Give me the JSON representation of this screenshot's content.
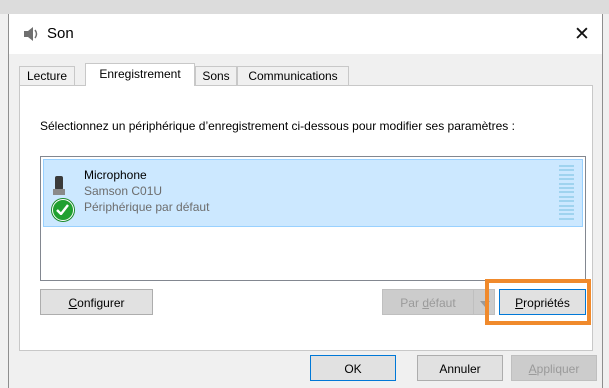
{
  "window": {
    "title": "Son",
    "title_icon": "speaker-icon",
    "close_label": "✕"
  },
  "tabs": [
    {
      "label": "Lecture",
      "active": false
    },
    {
      "label": "Enregistrement",
      "active": true
    },
    {
      "label": "Sons",
      "active": false
    },
    {
      "label": "Communications",
      "active": false
    }
  ],
  "instruction": "Sélectionnez un périphérique d’enregistrement ci-dessous pour modifier ses paramètres :",
  "device": {
    "name": "Microphone",
    "model": "Samson C01U",
    "status": "Périphérique par défaut",
    "icon": "microphone-icon",
    "status_icon": "checkmark-icon",
    "level_segments": 13
  },
  "buttons": {
    "configure": {
      "mnemonic": "C",
      "rest": "onfigurer"
    },
    "default": {
      "pre": "Par ",
      "mnemonic": "d",
      "rest": "éfaut"
    },
    "properties": {
      "mnemonic": "P",
      "rest": "ropriétés"
    },
    "ok": "OK",
    "cancel": "Annuler",
    "apply": {
      "mnemonic": "A",
      "rest": "ppliquer"
    }
  },
  "colors": {
    "highlight": "#f08a2c",
    "selection": "#cce8ff",
    "accent": "#0078d7",
    "check": "#20a030"
  }
}
